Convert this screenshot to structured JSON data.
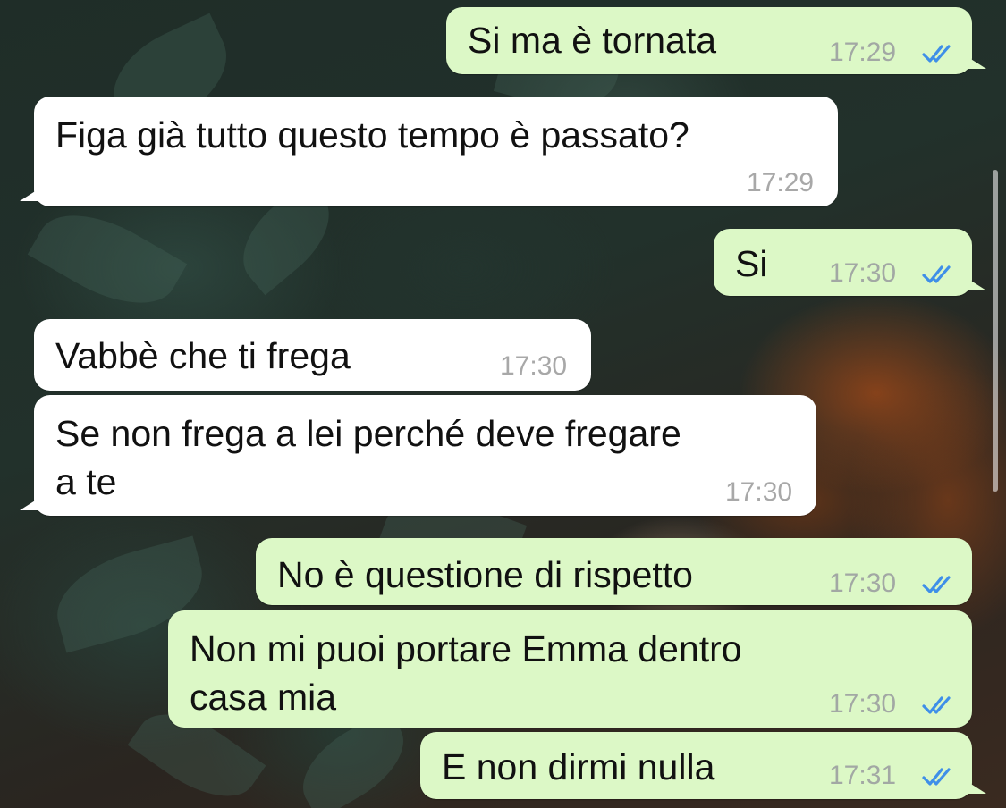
{
  "theme": {
    "outgoing_bubble": "#dcf8c6",
    "incoming_bubble": "#ffffff",
    "read_ticks": "#3f8fe8"
  },
  "messages": [
    {
      "direction": "out",
      "text": "Si ma è tornata",
      "time": "17:29",
      "status": "read"
    },
    {
      "direction": "in",
      "text": "Figa già tutto questo tempo è passato?",
      "time": "17:29"
    },
    {
      "direction": "out",
      "text": "Si",
      "time": "17:30",
      "status": "read"
    },
    {
      "direction": "in",
      "text": "Vabbè che ti frega",
      "time": "17:30"
    },
    {
      "direction": "in",
      "text_lines": [
        "Se non frega a lei perché deve fregare",
        "a te"
      ],
      "time": "17:30"
    },
    {
      "direction": "out",
      "text": "No è questione di rispetto",
      "time": "17:30",
      "status": "read"
    },
    {
      "direction": "out",
      "text_lines": [
        "Non mi puoi portare Emma dentro",
        "casa mia"
      ],
      "time": "17:30",
      "status": "read"
    },
    {
      "direction": "out",
      "text": "E non dirmi nulla",
      "time": "17:31",
      "status": "read"
    }
  ]
}
